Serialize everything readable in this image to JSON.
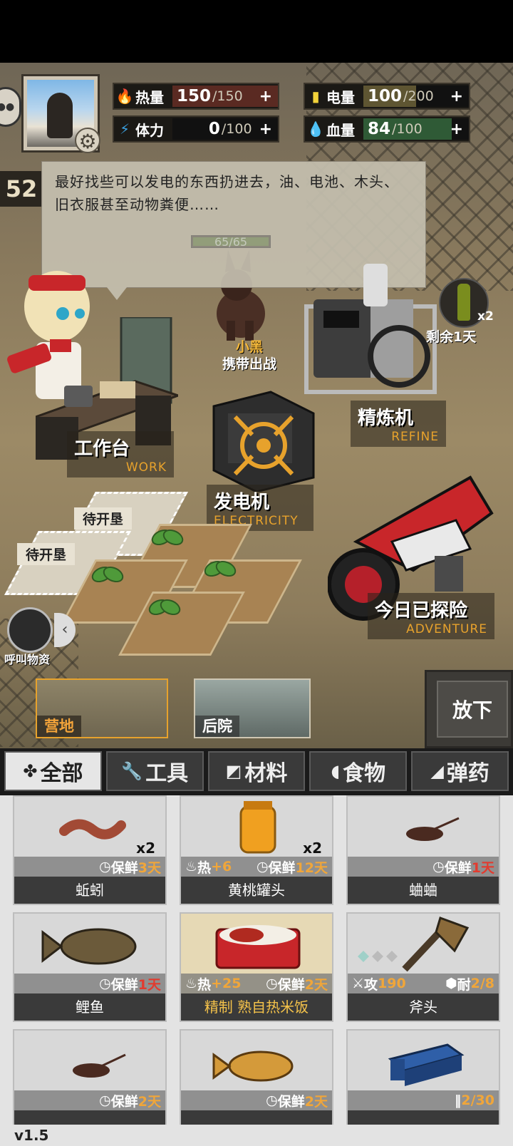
{
  "stats": {
    "calories": {
      "label": "热量",
      "value": "150",
      "max": "/150",
      "fill": 1.0
    },
    "power": {
      "label": "电量",
      "value": "100",
      "max": "/200",
      "fill": 0.5
    },
    "stamina": {
      "label": "体力",
      "value": "0",
      "max": "/100",
      "fill": 0.0
    },
    "health": {
      "label": "血量",
      "value": "84",
      "max": "/100",
      "fill": 0.84
    },
    "plus": "+"
  },
  "day_counter": "52",
  "dialog_text": "最好找些可以发电的东西扔进去，油、电池、木头、旧衣服甚至动物粪便……",
  "pet": {
    "hp": "65/65",
    "name": "小黑",
    "action": "携带出战"
  },
  "stations": {
    "workbench": {
      "cn": "工作台",
      "en": "WORK"
    },
    "generator": {
      "cn": "发电机",
      "en": "ELECTRICITY"
    },
    "refine": {
      "cn": "精炼机",
      "en": "REFINE"
    },
    "adventure": {
      "cn": "今日已探险",
      "en": "ADVENTURE"
    }
  },
  "bottle": {
    "count": "x2",
    "remaining": "剩余1天"
  },
  "plots": {
    "empty1": "待开垦",
    "empty2": "待开垦"
  },
  "call_supply": "呼叫物资",
  "locations": {
    "camp": "营地",
    "backyard": "后院"
  },
  "put_down": "放下",
  "categories": [
    {
      "glyph": "✤",
      "label": "全部"
    },
    {
      "glyph": "🔧",
      "label": "工具"
    },
    {
      "glyph": "◩",
      "label": "材料"
    },
    {
      "glyph": "◖",
      "label": "食物"
    },
    {
      "glyph": "◢",
      "label": "弹药"
    }
  ],
  "items": [
    {
      "name": "蚯蚓",
      "qty": "x2",
      "heat": "",
      "fresh_label": "保鲜",
      "fresh": "3天",
      "fresh_red": false
    },
    {
      "name": "黄桃罐头",
      "qty": "x2",
      "heat_label": "热",
      "heat": "+6",
      "fresh_label": "保鲜",
      "fresh": "12天",
      "fresh_red": false
    },
    {
      "name": "蛐蛐",
      "qty": "",
      "heat": "",
      "fresh_label": "保鲜",
      "fresh": "1天",
      "fresh_red": true
    },
    {
      "name": "鲤鱼",
      "qty": "",
      "heat": "",
      "fresh_label": "保鲜",
      "fresh": "1天",
      "fresh_red": true
    },
    {
      "name": "精制 熟自热米饭",
      "qty": "",
      "heat_label": "热",
      "heat": "+25",
      "fresh_label": "保鲜",
      "fresh": "2天",
      "fresh_red": false
    },
    {
      "name": "斧头",
      "atk_label": "攻",
      "atk": "190",
      "dur_label": "耐",
      "dur": "2/8"
    },
    {
      "name": "",
      "fresh_label": "保鲜",
      "fresh": "2天"
    },
    {
      "name": "",
      "fresh_label": "保鲜",
      "fresh": "2天"
    },
    {
      "name": "",
      "ammo": "2/30"
    }
  ],
  "version": "v1.5",
  "colors": {
    "accent_orange": "#e7a22c",
    "calorie_red": "#e23b2f",
    "stamina_blue": "#3aa0e0",
    "power_yellow": "#f2d23a",
    "health_green": "#56c26a"
  }
}
